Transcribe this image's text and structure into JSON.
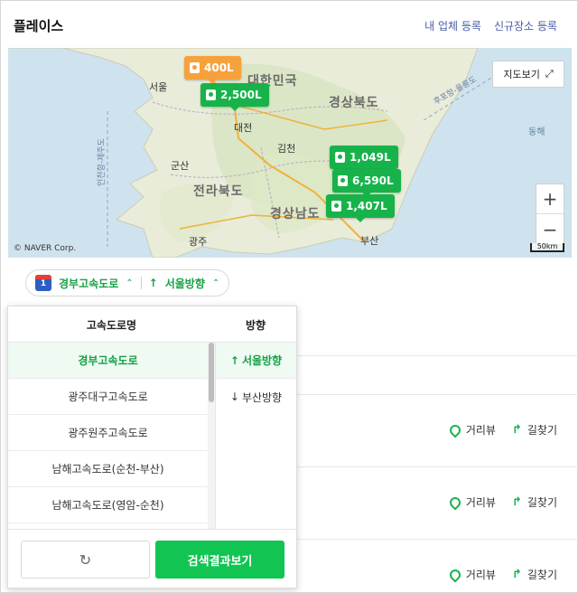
{
  "header": {
    "title": "플레이스",
    "links": [
      "내 업체 등록",
      "신규장소 등록"
    ]
  },
  "map": {
    "place_labels": {
      "seoul": "서울",
      "korea": "대한민국",
      "gyeongbuk": "경상북도",
      "daejeon": "대전",
      "gimcheon": "김천",
      "gunsan": "군산",
      "jeonbuk": "전라북도",
      "gyeongnam": "경상남도",
      "gwangju": "광주",
      "busan": "부산",
      "east_sea": "동해"
    },
    "route_labels": {
      "west": "인천항-제주도",
      "east": "후포항-울릉도"
    },
    "markers": [
      {
        "label": "400L",
        "color": "#f6a23c"
      },
      {
        "label": "2,500L",
        "color": "#17b34a"
      },
      {
        "label": "1,049L",
        "color": "#17b34a"
      },
      {
        "label": "6,590L",
        "color": "#17b34a"
      },
      {
        "label": "1,407L",
        "color": "#17b34a"
      }
    ],
    "map_view_button": "지도보기",
    "zoom_in": "+",
    "zoom_out": "−",
    "copyright": "© NAVER Corp.",
    "scale": "50km"
  },
  "filters": {
    "highway": "경부고속도로",
    "direction": "서울방향"
  },
  "panel": {
    "col1_header": "고속도로명",
    "col2_header": "방향",
    "highways": [
      "경부고속도로",
      "광주대구고속도로",
      "광주원주고속도로",
      "남해고속도로(순천-부산)",
      "남해고속도로(영암-순천)"
    ],
    "selected_highway": "경부고속도로",
    "directions": [
      {
        "arrow": "↑",
        "label": "서울방향"
      },
      {
        "arrow": "↓",
        "label": "부산방향"
      }
    ],
    "selected_direction": "서울방향",
    "reset_icon": "↻",
    "search_button": "검색결과보기"
  },
  "rows": [
    {
      "street_view": "거리뷰",
      "directions": "길찾기"
    },
    {
      "street_view": "거리뷰",
      "directions": "길찾기"
    },
    {
      "street_view": "거리뷰",
      "directions": "길찾기"
    }
  ]
}
